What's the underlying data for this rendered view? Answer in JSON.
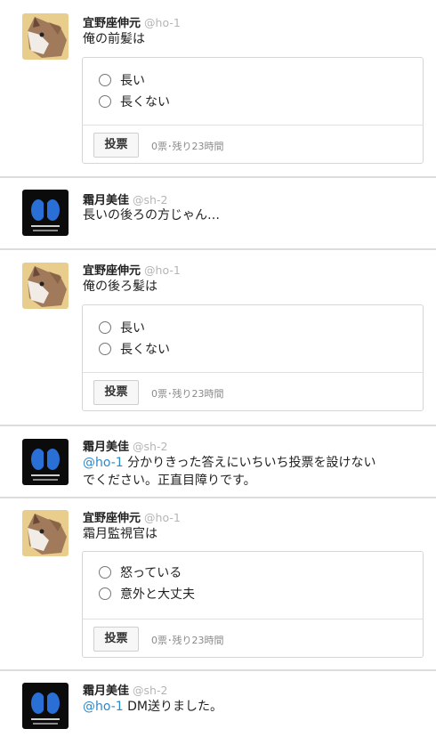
{
  "users": {
    "ho1": {
      "name": "宜野座伸元",
      "handle": "@ho-1",
      "avatar": "wolf-avatar-icon"
    },
    "sh2": {
      "name": "霜月美佳",
      "handle": "@sh-2",
      "avatar": "sibyl-logo-avatar-icon"
    }
  },
  "posts": [
    {
      "text": "俺の前髪は",
      "poll": {
        "options": [
          "長い",
          "長くない"
        ],
        "vote_label": "投票",
        "status": "0票･残り23時間"
      }
    },
    {
      "text": "長いの後ろの方じゃん…"
    },
    {
      "text": "俺の後ろ髪は",
      "poll": {
        "options": [
          "長い",
          "長くない"
        ],
        "vote_label": "投票",
        "status": "0票･残り23時間"
      }
    },
    {
      "mention": "@ho-1",
      "text_line1": " 分かりきった答えにいちいち投票を設けない",
      "text_line2": "でください。正直目障りです。"
    },
    {
      "text": "霜月監視官は",
      "poll": {
        "options": [
          "怒っている",
          "意外と大丈夫"
        ],
        "vote_label": "投票",
        "status": "0票･残り23時間"
      }
    },
    {
      "mention": "@ho-1",
      "text": " DM送りました。"
    }
  ]
}
